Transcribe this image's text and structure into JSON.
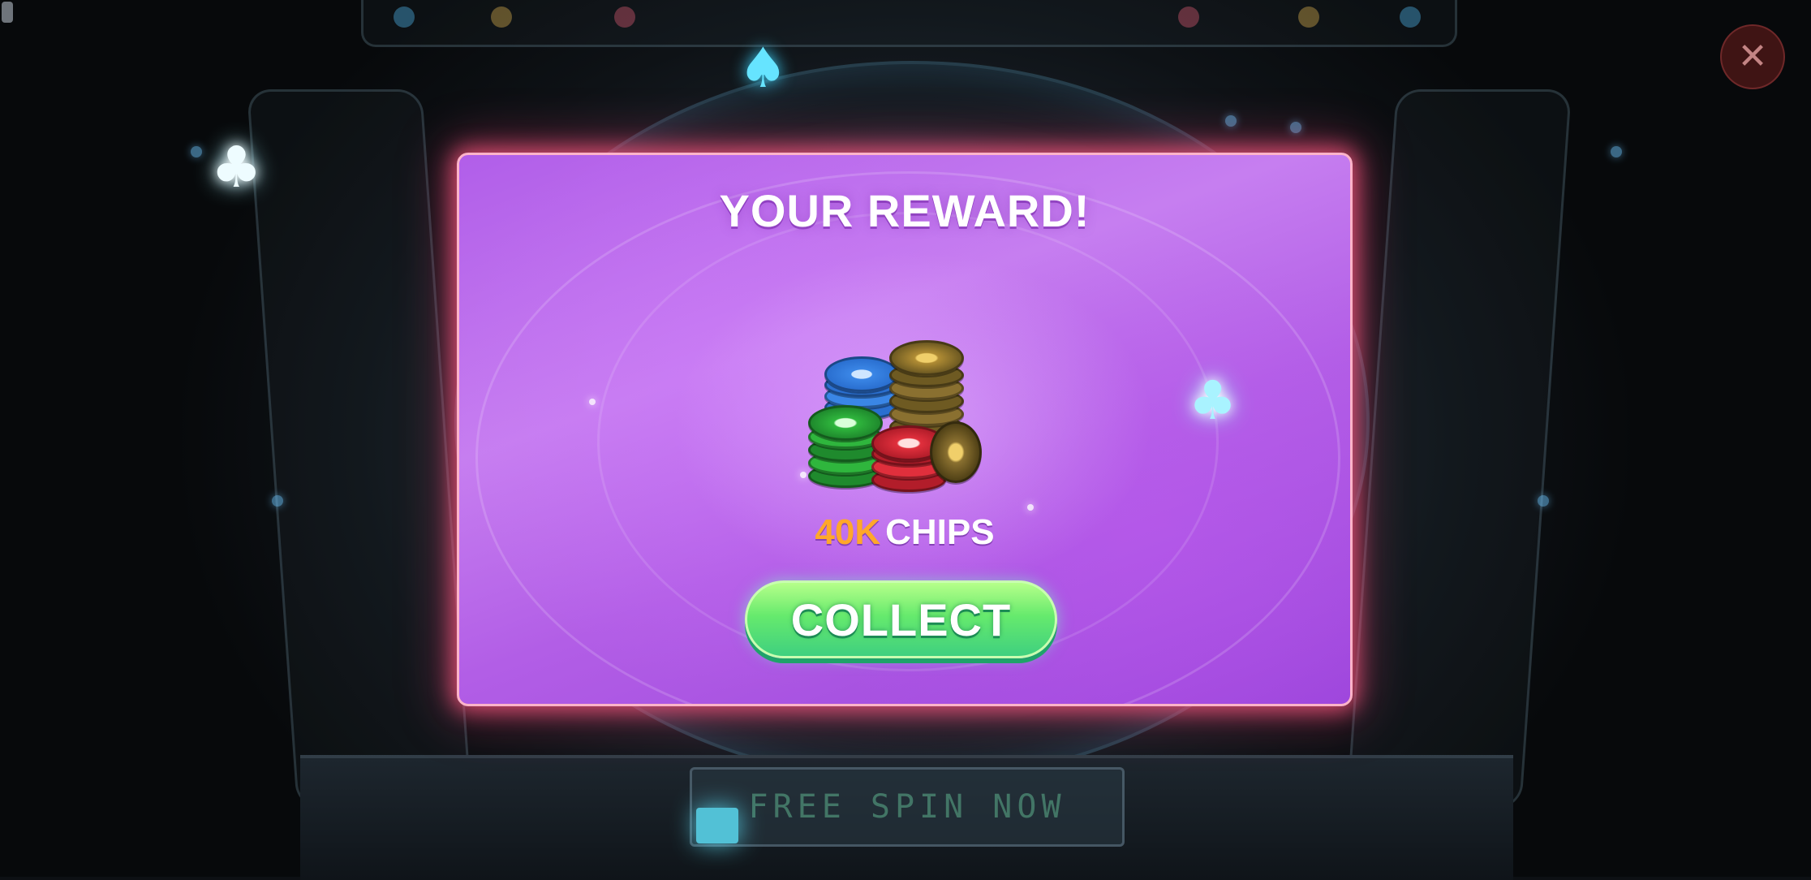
{
  "background": {
    "panel_text": "FREE SPIN NOW"
  },
  "close_button": {
    "icon": "close-icon",
    "glyph": "✕"
  },
  "modal": {
    "title": "YOUR REWARD!",
    "reward_icon": "poker-chips-icon",
    "reward_amount": "40K",
    "reward_unit": "CHIPS",
    "collect_label": "COLLECT"
  },
  "colors": {
    "modal_purple": "#b15ee9",
    "border_glow": "#ff5a82",
    "amount_orange": "#ffa72a",
    "button_green": "#66ea6d"
  }
}
